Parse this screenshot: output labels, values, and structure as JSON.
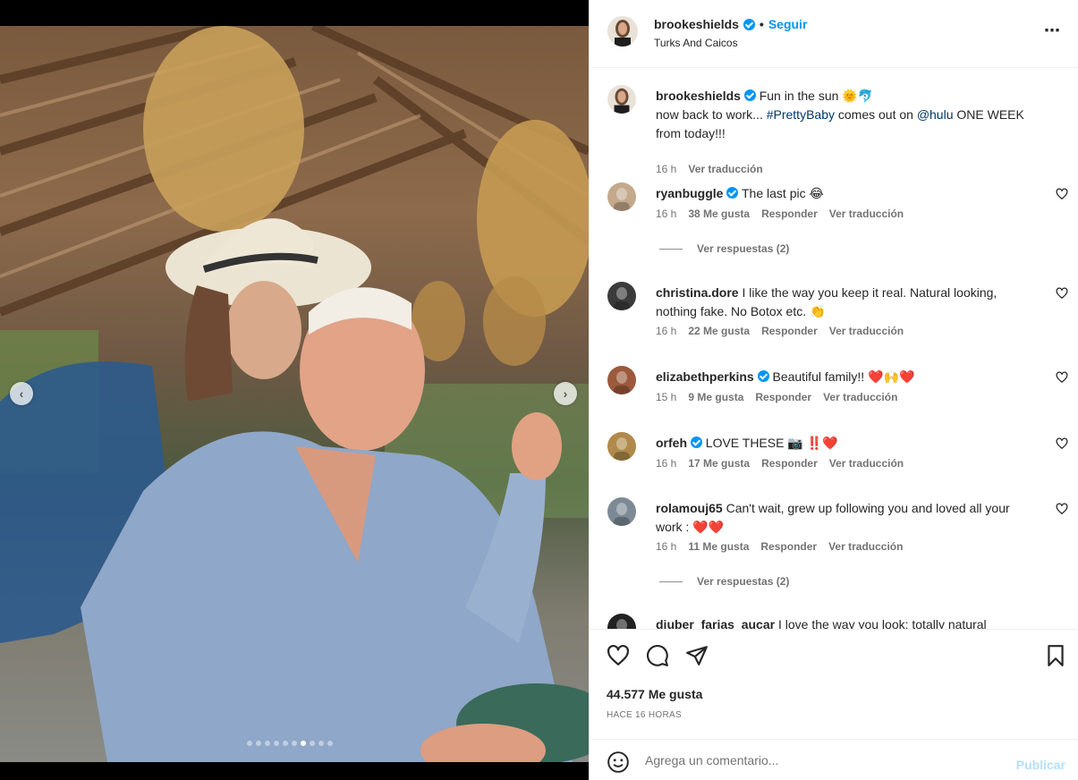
{
  "post": {
    "username": "brookeshields",
    "follow_label": "Seguir",
    "separator": "•",
    "location": "Turks And Caicos",
    "more_icon": "⋯"
  },
  "caption": {
    "username": "brookeshields",
    "text_line1": "Fun in the sun 🌞🐬",
    "text_pre": "now back to work... ",
    "hashtag": "#PrettyBaby",
    "text_mid": " comes out on ",
    "mention": "@hulu",
    "text_post": " ONE WEEK from today!!!",
    "time": "16 h",
    "translate": "Ver traducción"
  },
  "comments": [
    {
      "username": "ryanbuggle",
      "verified": true,
      "text": "The last pic 😂",
      "time": "16 h",
      "likes": "38 Me gusta",
      "reply": "Responder",
      "translate": "Ver traducción",
      "replies": "Ver respuestas (2)",
      "avatar_color": "#c4a98d"
    },
    {
      "username": "christina.dore",
      "verified": false,
      "text": "I like the way you keep it real. Natural looking, nothing fake. No Botox etc. 👏",
      "time": "16 h",
      "likes": "22 Me gusta",
      "reply": "Responder",
      "translate": "Ver traducción",
      "avatar_color": "#3b3b3b"
    },
    {
      "username": "elizabethperkins",
      "verified": true,
      "text": "Beautiful family!! ❤️🙌❤️",
      "time": "15 h",
      "likes": "9 Me gusta",
      "reply": "Responder",
      "translate": "Ver traducción",
      "avatar_color": "#9c5a3c"
    },
    {
      "username": "orfeh",
      "verified": true,
      "text": "LOVE THESE 📷 ‼️❤️",
      "time": "16 h",
      "likes": "17 Me gusta",
      "reply": "Responder",
      "translate": "Ver traducción",
      "avatar_color": "#b08a4a"
    },
    {
      "username": "rolamouj65",
      "verified": false,
      "text": "Can't wait, grew up following you and loved all your work : ❤️❤️",
      "time": "16 h",
      "likes": "11 Me gusta",
      "reply": "Responder",
      "translate": "Ver traducción",
      "replies": "Ver respuestas (2)",
      "avatar_color": "#7d8a96"
    },
    {
      "username": "djuber_farias_aucar",
      "verified": false,
      "text": "I love the way you look: totally natural",
      "avatar_color": "#222222"
    }
  ],
  "actions": {
    "likes": "44.577 Me gusta",
    "time_ago": "HACE 16 HORAS"
  },
  "comment_box": {
    "placeholder": "Agrega un comentario...",
    "publish": "Publicar"
  },
  "carousel": {
    "total": 10,
    "active": 7
  },
  "colors": {
    "accent": "#0095f6",
    "link": "#00376b",
    "muted": "#737373"
  }
}
